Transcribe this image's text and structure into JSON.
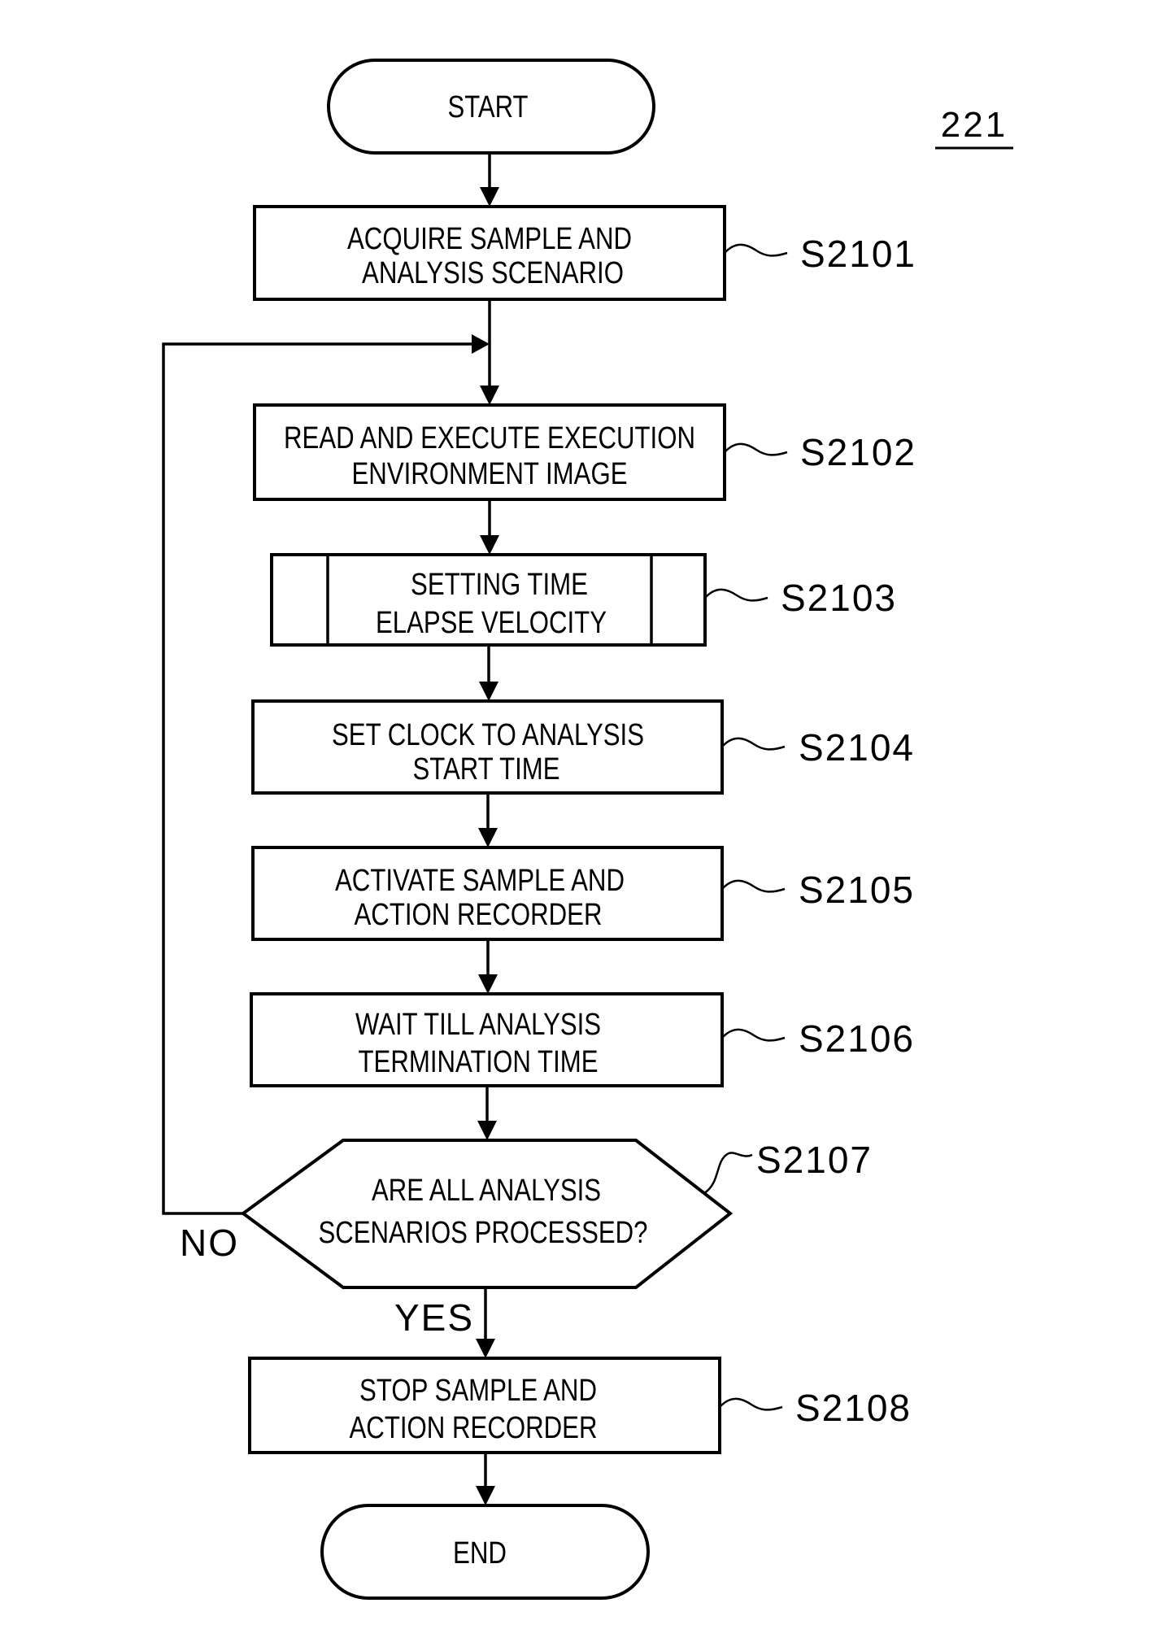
{
  "figure_ref": "221",
  "start": {
    "label": "START"
  },
  "end": {
    "label": "END"
  },
  "steps": [
    {
      "id": "S2101",
      "type": "process",
      "lines": [
        "ACQUIRE SAMPLE AND",
        "ANALYSIS SCENARIO"
      ]
    },
    {
      "id": "S2102",
      "type": "process",
      "lines": [
        "READ AND EXECUTE EXECUTION",
        "ENVIRONMENT IMAGE"
      ]
    },
    {
      "id": "S2103",
      "type": "predefined-process",
      "lines": [
        "SETTING TIME",
        "ELAPSE VELOCITY"
      ]
    },
    {
      "id": "S2104",
      "type": "process",
      "lines": [
        "SET CLOCK TO ANALYSIS",
        "START TIME"
      ]
    },
    {
      "id": "S2105",
      "type": "process",
      "lines": [
        "ACTIVATE SAMPLE AND",
        "ACTION RECORDER"
      ]
    },
    {
      "id": "S2106",
      "type": "process",
      "lines": [
        "WAIT TILL ANALYSIS",
        "TERMINATION TIME"
      ]
    },
    {
      "id": "S2107",
      "type": "decision",
      "lines": [
        "ARE ALL ANALYSIS",
        "SCENARIOS PROCESSED?"
      ]
    },
    {
      "id": "S2108",
      "type": "process",
      "lines": [
        "STOP SAMPLE AND",
        "ACTION RECORDER"
      ]
    }
  ],
  "branches": {
    "no": "NO",
    "yes": "YES"
  }
}
